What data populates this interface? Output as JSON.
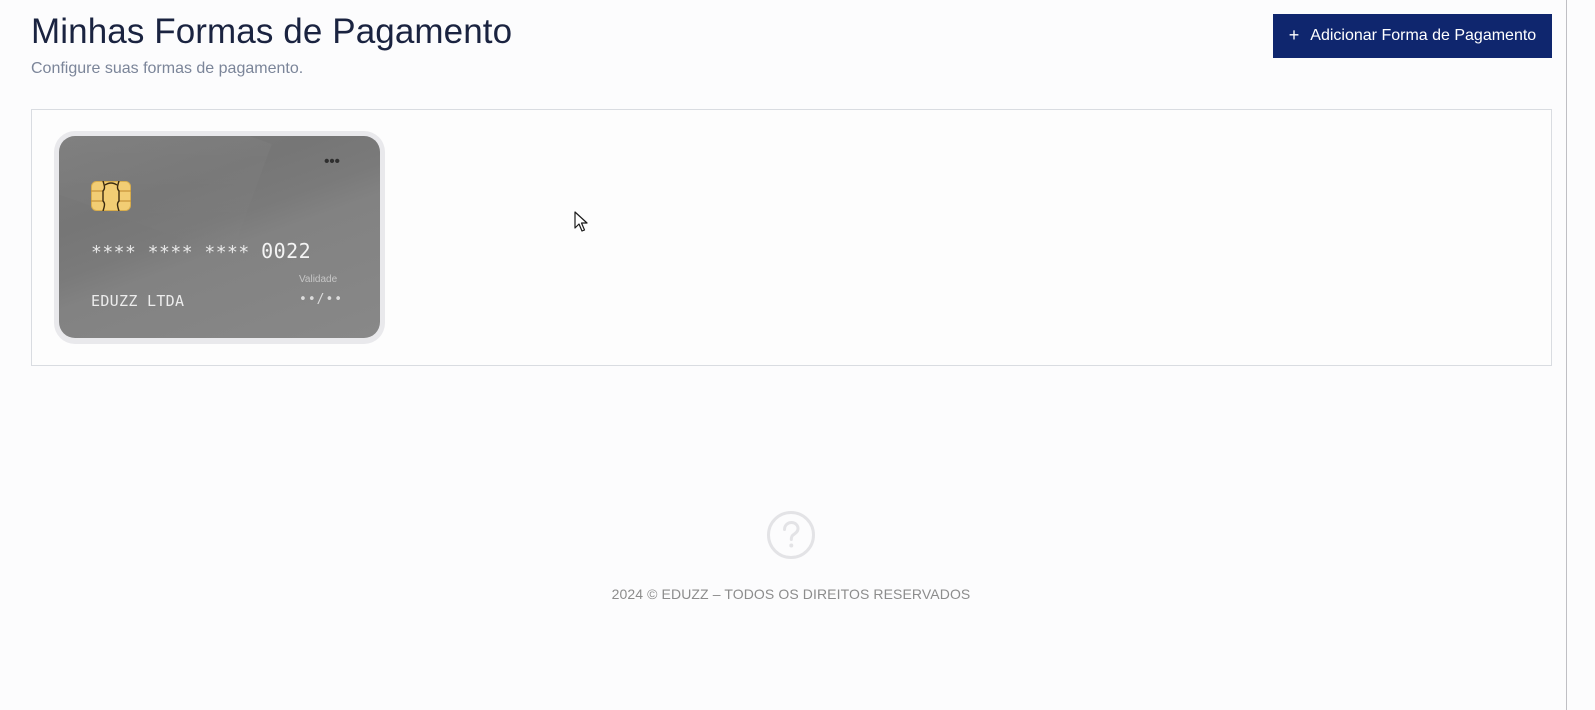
{
  "header": {
    "title": "Minhas Formas de Pagamento",
    "subtitle": "Configure suas formas de pagamento.",
    "add_button_icon": "plus-icon",
    "add_button_label": "Adicionar Forma de Pagamento"
  },
  "cards": [
    {
      "menu_label": "•••",
      "chip_icon": "chip-icon",
      "number_masked": "**** **** **** ",
      "number_last4": "0022",
      "validity_label": "Validade",
      "holder": "EDUZZ LTDA",
      "expiry": "••/••"
    }
  ],
  "footer": {
    "help_icon": "question-circle-icon",
    "copyright": "2024 © EDUZZ – TODOS OS DIREITOS RESERVADOS"
  },
  "colors": {
    "primary_button": "#0f266e",
    "title": "#1a2340",
    "subtitle": "#7b8599",
    "card": "#808080"
  }
}
